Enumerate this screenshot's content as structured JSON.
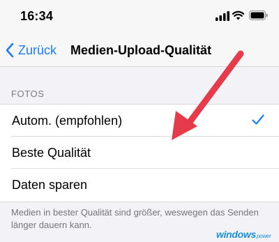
{
  "status_bar": {
    "time": "16:34"
  },
  "navbar": {
    "back_label": "Zurück",
    "title": "Medien-Upload-Qualität"
  },
  "section": {
    "header": "FOTOS"
  },
  "options": [
    {
      "label": "Autom. (empfohlen)",
      "selected": true
    },
    {
      "label": "Beste Qualität",
      "selected": false
    },
    {
      "label": "Daten sparen",
      "selected": false
    }
  ],
  "footer": {
    "note": "Medien in bester Qualität sind größer, weswegen das Senden länger dauern kann."
  },
  "watermark": {
    "text": "windows",
    "suffix": "power"
  },
  "colors": {
    "accent": "#1a7cf5",
    "arrow": "#e63b4a"
  }
}
